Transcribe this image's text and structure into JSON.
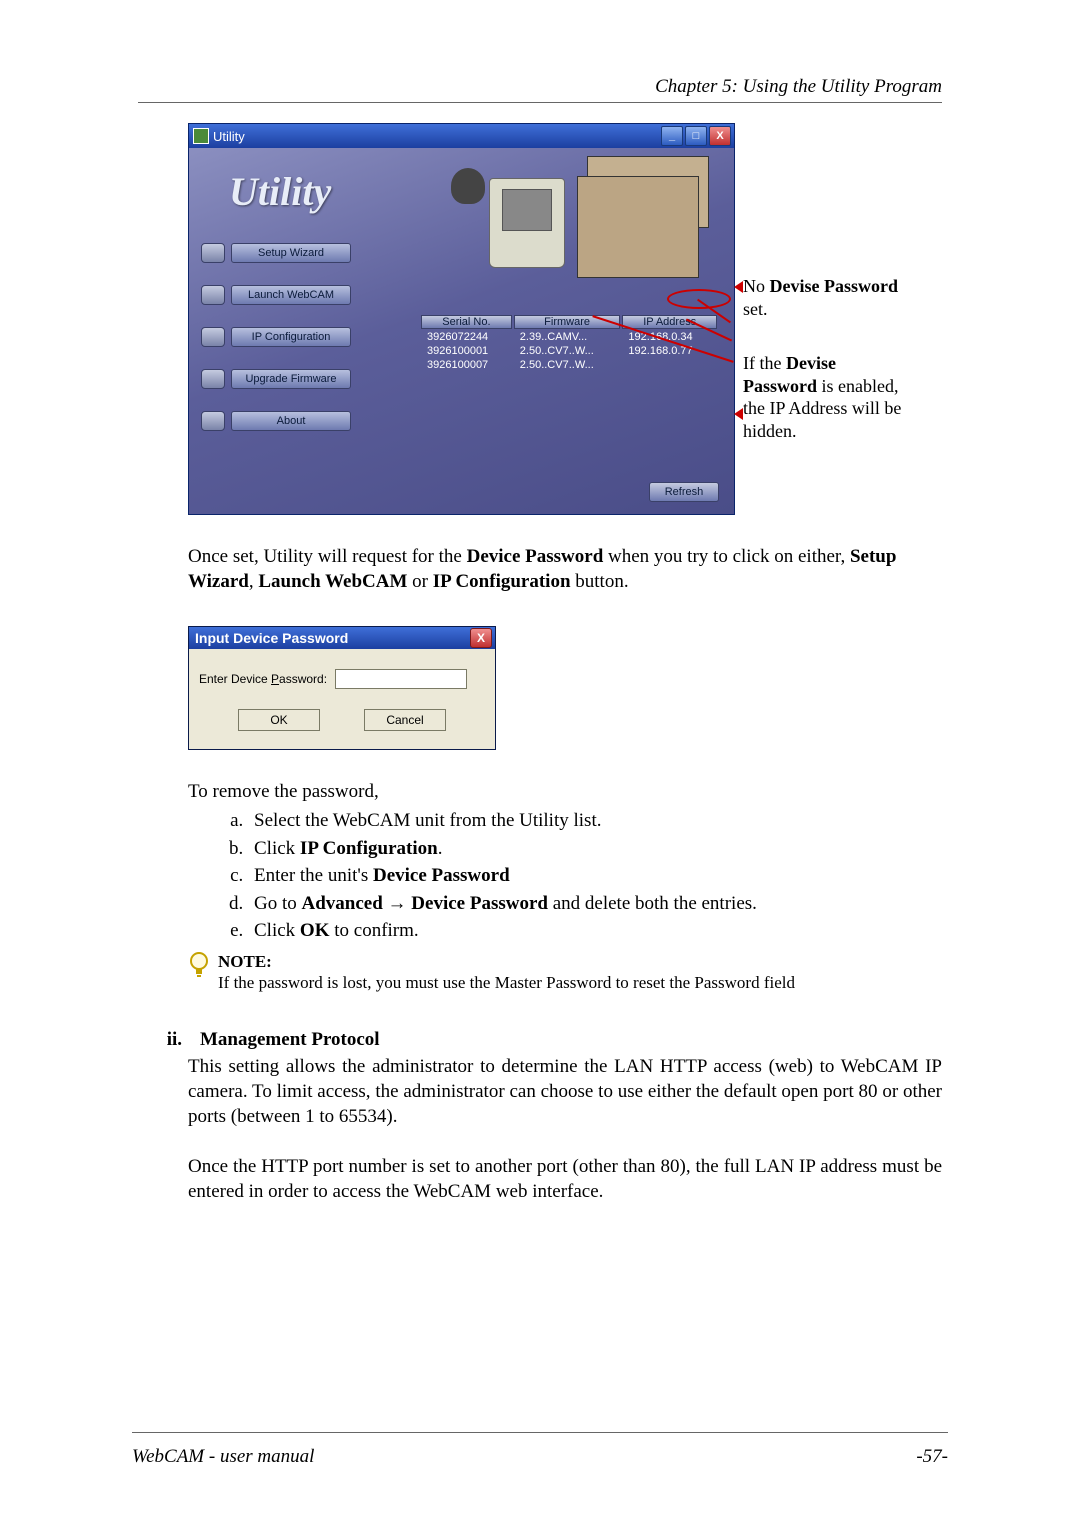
{
  "chapter": "Chapter 5: Using the Utility Program",
  "utility_window": {
    "title": "Utility",
    "logo": "Utility",
    "buttons": {
      "setup": "Setup Wizard",
      "launch": "Launch WebCAM",
      "ipconfig": "IP Configuration",
      "upgrade": "Upgrade Firmware",
      "about": "About"
    },
    "table": {
      "headers": {
        "serial": "Serial No.",
        "firmware": "Firmware",
        "ip": "IP Address"
      },
      "rows": [
        {
          "serial": "3926072244",
          "firmware": "2.39..CAMV...",
          "ip": "192.168.0.34"
        },
        {
          "serial": "3926100001",
          "firmware": "2.50..CV7..W...",
          "ip": "192.168.0.77"
        },
        {
          "serial": "3926100007",
          "firmware": "2.50..CV7..W...",
          "ip": ""
        }
      ]
    },
    "refresh": "Refresh"
  },
  "callouts": {
    "no_pw1": "No ",
    "no_pw1b": "Devise Password",
    "no_pw2": " set.",
    "if1": "If the ",
    "if1b": "Devise Password",
    "if2": " is enabled, the IP Address will be hidden.",
    "ip_bold": "IP"
  },
  "para1": {
    "a": "Once set, Utility will request for the ",
    "b": "Device Password",
    "c": " when you try to click on either, ",
    "d": "Setup Wizard",
    "e": ", ",
    "f": "Launch WebCAM",
    "g": " or ",
    "h": "IP Configuration",
    "i": " button."
  },
  "dialog": {
    "title": "Input Device Password",
    "label_pre": "Enter Device ",
    "label_u": "P",
    "label_post": "assword:",
    "ok": "OK",
    "cancel": "Cancel"
  },
  "remove_intro": "To remove the password,",
  "remove": {
    "a": "Select the WebCAM unit from the Utility list.",
    "b1": "Click ",
    "b2": "IP Configuration",
    "b3": ".",
    "c1": "Enter the unit's ",
    "c2": "Device Password",
    "d1": "Go to ",
    "d2": "Advanced",
    "d3": " → ",
    "d4": "Device Password",
    "d5": " and delete both the entries.",
    "e1": "Click ",
    "e2": "OK",
    "e3": " to confirm."
  },
  "note": {
    "title": "NOTE:",
    "body": "If the password is lost, you must use the Master Password to reset the Password field"
  },
  "subsection": {
    "num": "ii.",
    "title": "Management Protocol"
  },
  "mgmt_p1": "This setting allows the administrator to determine the LAN HTTP access (web) to WebCAM IP camera.   To limit access, the administrator can choose to use either the default open port 80 or other ports (between 1 to 65534).",
  "mgmt_p2": "Once the HTTP port number is set to another port (other than 80), the full LAN IP address must be entered in order to access the WebCAM web interface.",
  "footer": {
    "left": "WebCAM - user manual",
    "right": "-57-"
  }
}
